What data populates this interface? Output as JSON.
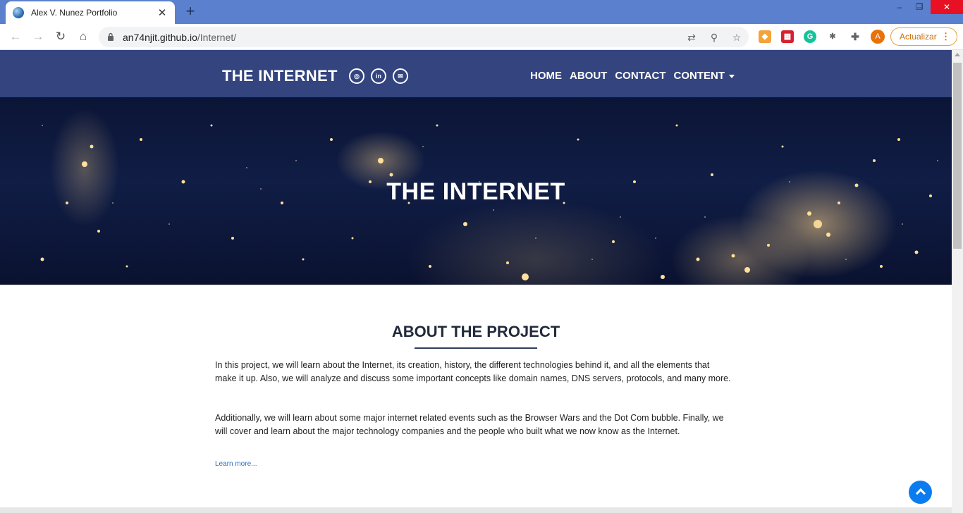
{
  "browser": {
    "tab_title": "Alex V. Nunez Portfolio",
    "tab_close": "✕",
    "new_tab": "+",
    "url_host": "an74njit.github.io",
    "url_path": "/Internet/",
    "profile_initial": "A",
    "update_label": "Actualizar",
    "window_controls": [
      "–",
      "❐",
      "✕"
    ],
    "accent_color": "#5b80cd"
  },
  "site": {
    "brand": "THE INTERNET",
    "social_icons": [
      "instagram-icon",
      "linkedin-icon",
      "mail-icon"
    ],
    "nav": {
      "home": "HOME",
      "about": "ABOUT",
      "contact": "CONTACT",
      "content": "CONTENT"
    },
    "nav_color": "#33447e"
  },
  "hero": {
    "title": "THE INTERNET"
  },
  "about": {
    "title": "ABOUT THE PROJECT",
    "paragraph1": "In this project, we will learn about the Internet, its creation, history, the different technologies behind it, and all the elements that make it up. Also, we will analyze and discuss some important concepts like domain names, DNS servers, protocols, and many more.",
    "paragraph2": "Additionally, we will learn about some major internet related events such as the Browser Wars and the Dot Com bubble. Finally, we will cover and learn about the major technology companies and the people who built what we now know as the Internet.",
    "learn_more": "Learn more..."
  }
}
